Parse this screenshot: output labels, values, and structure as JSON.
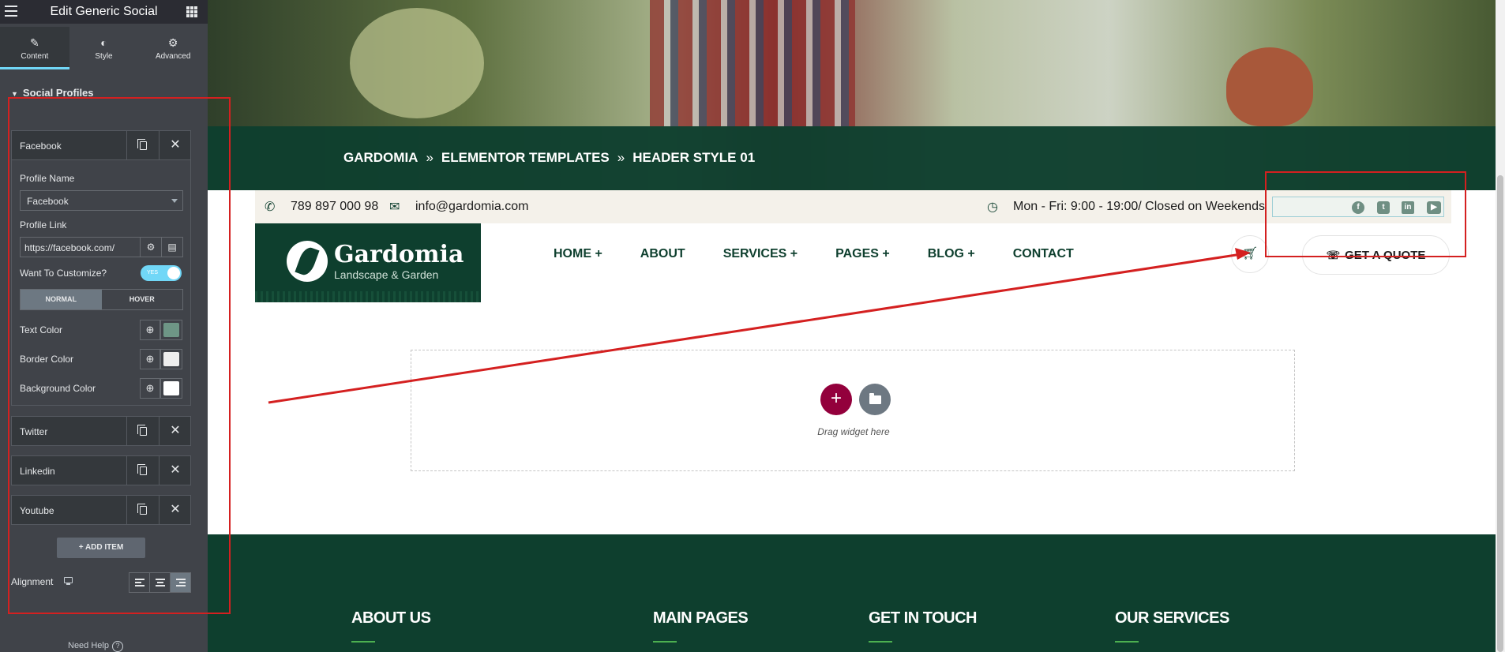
{
  "editor": {
    "title": "Edit Generic Social",
    "tabs": [
      {
        "label": "Content",
        "icon": "pencil-icon"
      },
      {
        "label": "Style",
        "icon": "half-circle-icon"
      },
      {
        "label": "Advanced",
        "icon": "gear-icon"
      }
    ],
    "section_title": "Social Profiles",
    "items": [
      "Facebook",
      "Twitter",
      "Linkedin",
      "Youtube"
    ],
    "fields": {
      "profile_name_label": "Profile Name",
      "profile_name_value": "Facebook",
      "profile_link_label": "Profile Link",
      "profile_link_value": "https://facebook.com/",
      "customize_label": "Want To Customize?",
      "toggle_text": "YES",
      "normal_tab": "NORMAL",
      "hover_tab": "HOVER",
      "text_color_label": "Text Color",
      "border_color_label": "Border Color",
      "background_color_label": "Background Color",
      "text_color": "#6e9686",
      "border_color": "#eeeeee",
      "background_color": "#ffffff"
    },
    "add_item_label": "ADD ITEM",
    "alignment_label": "Alignment",
    "need_help": "Need Help"
  },
  "preview": {
    "breadcrumb": [
      "GARDOMIA",
      "ELEMENTOR TEMPLATES",
      "HEADER STYLE 01"
    ],
    "phone": "789 897 000 98",
    "email": "info@gardomia.com",
    "hours": "Mon - Fri: 9:00 - 19:00/ Closed on Weekends",
    "logo_name": "Gardomia",
    "logo_tagline": "Landscape & Garden",
    "nav": [
      "HOME +",
      "ABOUT",
      "SERVICES +",
      "PAGES +",
      "BLOG +",
      "CONTACT"
    ],
    "quote_button": "GET A QUOTE",
    "drop_text": "Drag widget here",
    "footer_headings": [
      "ABOUT US",
      "MAIN PAGES",
      "GET IN TOUCH",
      "OUR SERVICES"
    ],
    "social_icons": [
      "facebook-icon",
      "twitter-icon",
      "linkedin-icon",
      "youtube-icon"
    ]
  },
  "colors": {
    "accent": "#0e3f2e",
    "panel": "#404349",
    "annotation": "#d42020",
    "add_button": "#93003c"
  }
}
